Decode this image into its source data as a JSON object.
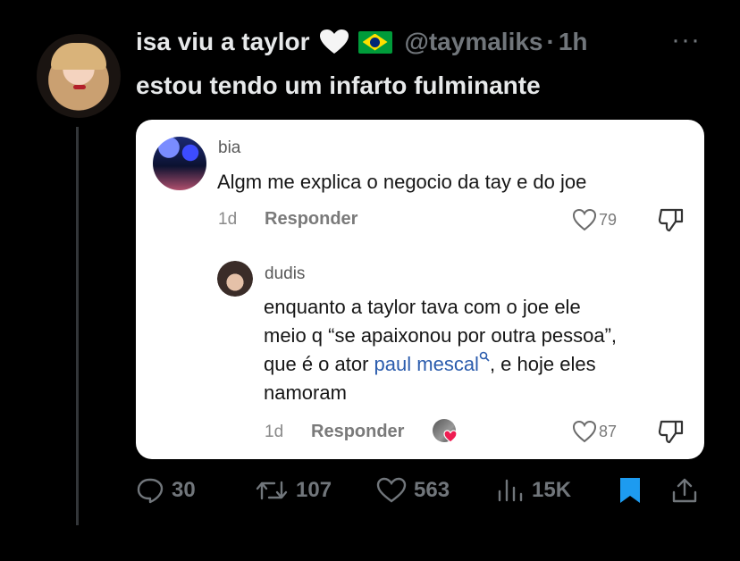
{
  "tweet": {
    "display_name": "isa viu a taylor",
    "handle": "@taymaliks",
    "separator": "·",
    "time": "1h",
    "text": "estou tendo um infarto fulminante",
    "more_icon": "more-icon"
  },
  "card": {
    "comment1": {
      "user": "bia",
      "text": "Algm me explica o negocio da tay e do joe",
      "age": "1d",
      "reply_label": "Responder",
      "likes": "79"
    },
    "comment2": {
      "user": "dudis",
      "line1": "enquanto a taylor tava com o joe ele",
      "line2": "meio q “se apaixonou por outra pessoa”,",
      "line3_pre": "que é o ator ",
      "line3_link": "paul mescal",
      "line3_post": ", e hoje eles",
      "line4": "namoram",
      "age": "1d",
      "reply_label": "Responder",
      "likes": "87"
    }
  },
  "actions": {
    "replies": "30",
    "retweets": "107",
    "likes": "563",
    "views": "15K"
  },
  "colors": {
    "background": "#000000",
    "bookmark": "#1d9bf0",
    "link": "#2b5cad"
  }
}
